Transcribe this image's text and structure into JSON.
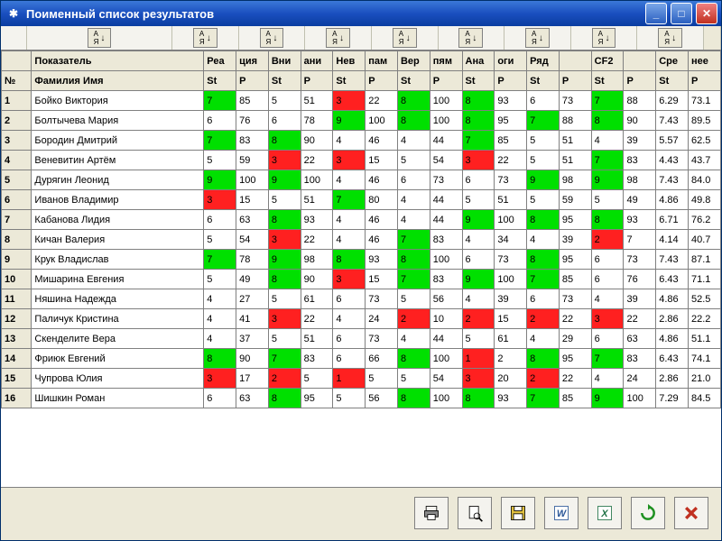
{
  "window": {
    "title": "Поименный список результатов"
  },
  "sort_button_label": "А↓\nЯ↓",
  "columns_top": [
    "",
    "Показатель",
    "Реа",
    "ция",
    "Вни",
    "ани",
    "Нев",
    "пам",
    "Вер",
    "пям",
    "Ана",
    "оги",
    "Ряд",
    "",
    "CF2",
    "",
    "Сре",
    "нее"
  ],
  "columns_sub": [
    "№",
    "Фамилия Имя",
    "St",
    "P",
    "St",
    "P",
    "St",
    "P",
    "St",
    "P",
    "St",
    "P",
    "St",
    "P",
    "St",
    "P",
    "St",
    "P"
  ],
  "rows": [
    {
      "n": "1",
      "name": "Бойко Виктория",
      "cells": [
        {
          "v": "7",
          "c": "g"
        },
        {
          "v": "85"
        },
        {
          "v": "5"
        },
        {
          "v": "51"
        },
        {
          "v": "3",
          "c": "r"
        },
        {
          "v": "22"
        },
        {
          "v": "8",
          "c": "g"
        },
        {
          "v": "100"
        },
        {
          "v": "8",
          "c": "g"
        },
        {
          "v": "93"
        },
        {
          "v": "6"
        },
        {
          "v": "73"
        },
        {
          "v": "7",
          "c": "g"
        },
        {
          "v": "88"
        },
        {
          "v": "6.29"
        },
        {
          "v": "73.1"
        }
      ]
    },
    {
      "n": "2",
      "name": "Болтычева Мария",
      "cells": [
        {
          "v": "6"
        },
        {
          "v": "76"
        },
        {
          "v": "6"
        },
        {
          "v": "78"
        },
        {
          "v": "9",
          "c": "g"
        },
        {
          "v": "100"
        },
        {
          "v": "8",
          "c": "g"
        },
        {
          "v": "100"
        },
        {
          "v": "8",
          "c": "g"
        },
        {
          "v": "95"
        },
        {
          "v": "7",
          "c": "g"
        },
        {
          "v": "88"
        },
        {
          "v": "8",
          "c": "g"
        },
        {
          "v": "90"
        },
        {
          "v": "7.43"
        },
        {
          "v": "89.5"
        }
      ]
    },
    {
      "n": "3",
      "name": "Бородин Дмитрий",
      "cells": [
        {
          "v": "7",
          "c": "g"
        },
        {
          "v": "83"
        },
        {
          "v": "8",
          "c": "g"
        },
        {
          "v": "90"
        },
        {
          "v": "4"
        },
        {
          "v": "46"
        },
        {
          "v": "4"
        },
        {
          "v": "44"
        },
        {
          "v": "7",
          "c": "g"
        },
        {
          "v": "85"
        },
        {
          "v": "5"
        },
        {
          "v": "51"
        },
        {
          "v": "4"
        },
        {
          "v": "39"
        },
        {
          "v": "5.57"
        },
        {
          "v": "62.5"
        }
      ]
    },
    {
      "n": "4",
      "name": "Веневитин Артём",
      "cells": [
        {
          "v": "5"
        },
        {
          "v": "59"
        },
        {
          "v": "3",
          "c": "r"
        },
        {
          "v": "22"
        },
        {
          "v": "3",
          "c": "r"
        },
        {
          "v": "15"
        },
        {
          "v": "5"
        },
        {
          "v": "54"
        },
        {
          "v": "3",
          "c": "r"
        },
        {
          "v": "22"
        },
        {
          "v": "5"
        },
        {
          "v": "51"
        },
        {
          "v": "7",
          "c": "g"
        },
        {
          "v": "83"
        },
        {
          "v": "4.43"
        },
        {
          "v": "43.7"
        }
      ]
    },
    {
      "n": "5",
      "name": "Дурягин Леонид",
      "cells": [
        {
          "v": "9",
          "c": "g"
        },
        {
          "v": "100"
        },
        {
          "v": "9",
          "c": "g"
        },
        {
          "v": "100"
        },
        {
          "v": "4"
        },
        {
          "v": "46"
        },
        {
          "v": "6"
        },
        {
          "v": "73"
        },
        {
          "v": "6"
        },
        {
          "v": "73"
        },
        {
          "v": "9",
          "c": "g"
        },
        {
          "v": "98"
        },
        {
          "v": "9",
          "c": "g"
        },
        {
          "v": "98"
        },
        {
          "v": "7.43"
        },
        {
          "v": "84.0"
        }
      ]
    },
    {
      "n": "6",
      "name": "Иванов Владимир",
      "cells": [
        {
          "v": "3",
          "c": "r"
        },
        {
          "v": "15"
        },
        {
          "v": "5"
        },
        {
          "v": "51"
        },
        {
          "v": "7",
          "c": "g"
        },
        {
          "v": "80"
        },
        {
          "v": "4"
        },
        {
          "v": "44"
        },
        {
          "v": "5"
        },
        {
          "v": "51"
        },
        {
          "v": "5"
        },
        {
          "v": "59"
        },
        {
          "v": "5"
        },
        {
          "v": "49"
        },
        {
          "v": "4.86"
        },
        {
          "v": "49.8"
        }
      ]
    },
    {
      "n": "7",
      "name": "Кабанова Лидия",
      "cells": [
        {
          "v": "6"
        },
        {
          "v": "63"
        },
        {
          "v": "8",
          "c": "g"
        },
        {
          "v": "93"
        },
        {
          "v": "4"
        },
        {
          "v": "46"
        },
        {
          "v": "4"
        },
        {
          "v": "44"
        },
        {
          "v": "9",
          "c": "g"
        },
        {
          "v": "100"
        },
        {
          "v": "8",
          "c": "g"
        },
        {
          "v": "95"
        },
        {
          "v": "8",
          "c": "g"
        },
        {
          "v": "93"
        },
        {
          "v": "6.71"
        },
        {
          "v": "76.2"
        }
      ]
    },
    {
      "n": "8",
      "name": "Кичан Валерия",
      "cells": [
        {
          "v": "5"
        },
        {
          "v": "54"
        },
        {
          "v": "3",
          "c": "r"
        },
        {
          "v": "22"
        },
        {
          "v": "4"
        },
        {
          "v": "46"
        },
        {
          "v": "7",
          "c": "g"
        },
        {
          "v": "83"
        },
        {
          "v": "4"
        },
        {
          "v": "34"
        },
        {
          "v": "4"
        },
        {
          "v": "39"
        },
        {
          "v": "2",
          "c": "r"
        },
        {
          "v": "7"
        },
        {
          "v": "4.14"
        },
        {
          "v": "40.7"
        }
      ]
    },
    {
      "n": "9",
      "name": "Крук Владислав",
      "cells": [
        {
          "v": "7",
          "c": "g"
        },
        {
          "v": "78"
        },
        {
          "v": "9",
          "c": "g"
        },
        {
          "v": "98"
        },
        {
          "v": "8",
          "c": "g"
        },
        {
          "v": "93"
        },
        {
          "v": "8",
          "c": "g"
        },
        {
          "v": "100"
        },
        {
          "v": "6"
        },
        {
          "v": "73"
        },
        {
          "v": "8",
          "c": "g"
        },
        {
          "v": "95"
        },
        {
          "v": "6"
        },
        {
          "v": "73"
        },
        {
          "v": "7.43"
        },
        {
          "v": "87.1"
        }
      ]
    },
    {
      "n": "10",
      "name": "Мишарина Евгения",
      "cells": [
        {
          "v": "5"
        },
        {
          "v": "49"
        },
        {
          "v": "8",
          "c": "g"
        },
        {
          "v": "90"
        },
        {
          "v": "3",
          "c": "r"
        },
        {
          "v": "15"
        },
        {
          "v": "7",
          "c": "g"
        },
        {
          "v": "83"
        },
        {
          "v": "9",
          "c": "g"
        },
        {
          "v": "100"
        },
        {
          "v": "7",
          "c": "g"
        },
        {
          "v": "85"
        },
        {
          "v": "6"
        },
        {
          "v": "76"
        },
        {
          "v": "6.43"
        },
        {
          "v": "71.1"
        }
      ]
    },
    {
      "n": "11",
      "name": "Няшина Надежда",
      "cells": [
        {
          "v": "4"
        },
        {
          "v": "27"
        },
        {
          "v": "5"
        },
        {
          "v": "61"
        },
        {
          "v": "6"
        },
        {
          "v": "73"
        },
        {
          "v": "5"
        },
        {
          "v": "56"
        },
        {
          "v": "4"
        },
        {
          "v": "39"
        },
        {
          "v": "6"
        },
        {
          "v": "73"
        },
        {
          "v": "4"
        },
        {
          "v": "39"
        },
        {
          "v": "4.86"
        },
        {
          "v": "52.5"
        }
      ]
    },
    {
      "n": "12",
      "name": "Паличук Кристина",
      "cells": [
        {
          "v": "4"
        },
        {
          "v": "41"
        },
        {
          "v": "3",
          "c": "r"
        },
        {
          "v": "22"
        },
        {
          "v": "4"
        },
        {
          "v": "24"
        },
        {
          "v": "2",
          "c": "r"
        },
        {
          "v": "10"
        },
        {
          "v": "2",
          "c": "r"
        },
        {
          "v": "15"
        },
        {
          "v": "2",
          "c": "r"
        },
        {
          "v": "22"
        },
        {
          "v": "3",
          "c": "r"
        },
        {
          "v": "22"
        },
        {
          "v": "2.86"
        },
        {
          "v": "22.2"
        }
      ]
    },
    {
      "n": "13",
      "name": "Скенделите Вера",
      "cells": [
        {
          "v": "4"
        },
        {
          "v": "37"
        },
        {
          "v": "5"
        },
        {
          "v": "51"
        },
        {
          "v": "6"
        },
        {
          "v": "73"
        },
        {
          "v": "4"
        },
        {
          "v": "44"
        },
        {
          "v": "5"
        },
        {
          "v": "61"
        },
        {
          "v": "4"
        },
        {
          "v": "29"
        },
        {
          "v": "6"
        },
        {
          "v": "63"
        },
        {
          "v": "4.86"
        },
        {
          "v": "51.1"
        }
      ]
    },
    {
      "n": "14",
      "name": "Фриюк Евгений",
      "cells": [
        {
          "v": "8",
          "c": "g"
        },
        {
          "v": "90"
        },
        {
          "v": "7",
          "c": "g"
        },
        {
          "v": "83"
        },
        {
          "v": "6"
        },
        {
          "v": "66"
        },
        {
          "v": "8",
          "c": "g"
        },
        {
          "v": "100"
        },
        {
          "v": "1",
          "c": "r"
        },
        {
          "v": "2"
        },
        {
          "v": "8",
          "c": "g"
        },
        {
          "v": "95"
        },
        {
          "v": "7",
          "c": "g"
        },
        {
          "v": "83"
        },
        {
          "v": "6.43"
        },
        {
          "v": "74.1"
        }
      ]
    },
    {
      "n": "15",
      "name": "Чупрова Юлия",
      "cells": [
        {
          "v": "3",
          "c": "r"
        },
        {
          "v": "17"
        },
        {
          "v": "2",
          "c": "r"
        },
        {
          "v": "5"
        },
        {
          "v": "1",
          "c": "r"
        },
        {
          "v": "5"
        },
        {
          "v": "5"
        },
        {
          "v": "54"
        },
        {
          "v": "3",
          "c": "r"
        },
        {
          "v": "20"
        },
        {
          "v": "2",
          "c": "r"
        },
        {
          "v": "22"
        },
        {
          "v": "4"
        },
        {
          "v": "24"
        },
        {
          "v": "2.86"
        },
        {
          "v": "21.0"
        }
      ]
    },
    {
      "n": "16",
      "name": "Шишкин Роман",
      "cells": [
        {
          "v": "6"
        },
        {
          "v": "63"
        },
        {
          "v": "8",
          "c": "g"
        },
        {
          "v": "95"
        },
        {
          "v": "5"
        },
        {
          "v": "56"
        },
        {
          "v": "8",
          "c": "g"
        },
        {
          "v": "100"
        },
        {
          "v": "8",
          "c": "g"
        },
        {
          "v": "93"
        },
        {
          "v": "7",
          "c": "g"
        },
        {
          "v": "85"
        },
        {
          "v": "9",
          "c": "g"
        },
        {
          "v": "100"
        },
        {
          "v": "7.29"
        },
        {
          "v": "84.5"
        }
      ]
    }
  ],
  "footer_buttons": [
    "print",
    "preview",
    "save",
    "word",
    "excel",
    "refresh",
    "close"
  ]
}
